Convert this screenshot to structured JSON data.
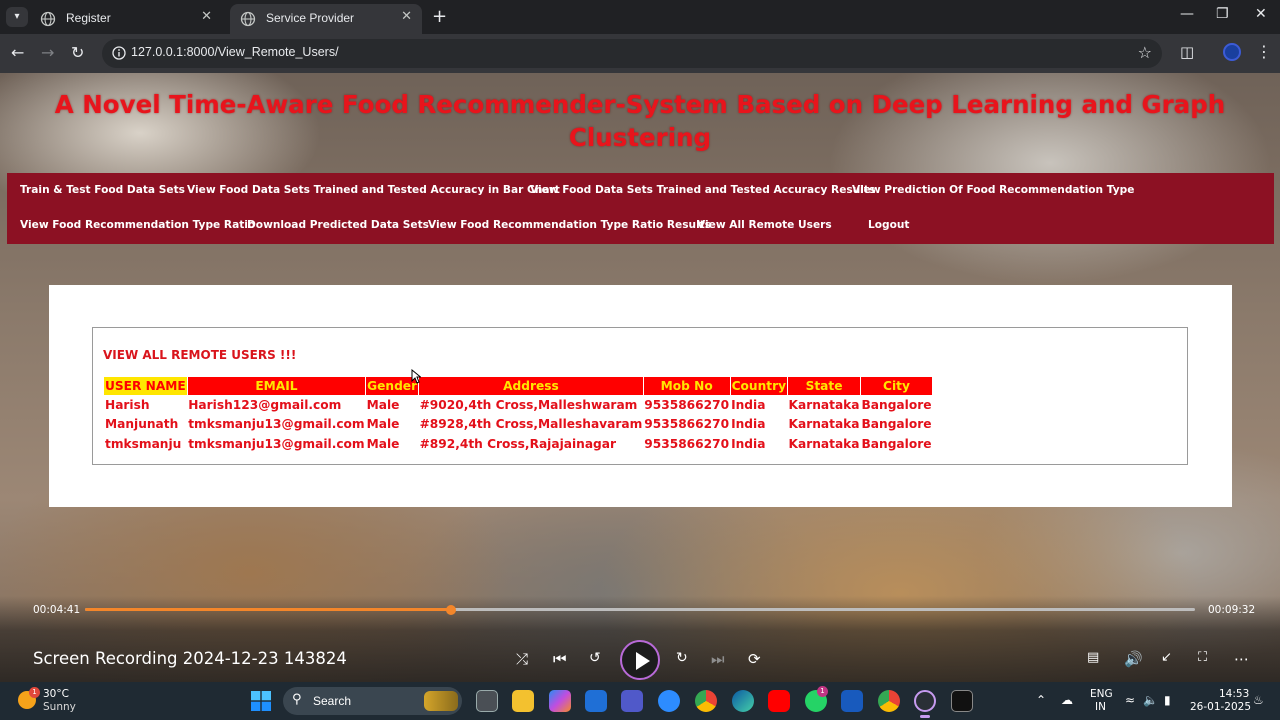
{
  "browser": {
    "tabs": [
      {
        "title": "Register",
        "active": false
      },
      {
        "title": "Service Provider",
        "active": true
      }
    ],
    "url": "127.0.0.1:8000/View_Remote_Users/"
  },
  "page": {
    "title": "A Novel Time-Aware Food Recommender-System Based on Deep Learning and Graph Clustering",
    "menu_row1": [
      "Train & Test Food Data Sets",
      "View Food Data Sets Trained and Tested Accuracy in Bar Chart",
      "View Food Data Sets Trained and Tested Accuracy Results",
      "View Prediction Of Food Recommendation Type"
    ],
    "menu_row2": [
      "View Food Recommendation Type Ratio",
      "Download Predicted Data Sets",
      "View Food Recommendation Type Ratio Results",
      "View All Remote Users",
      "Logout"
    ],
    "section_heading": "VIEW ALL REMOTE USERS !!!",
    "table": {
      "headers": [
        "USER NAME",
        "EMAIL",
        "Gender",
        "Address",
        "Mob No",
        "Country",
        "State",
        "City"
      ],
      "rows": [
        [
          "Harish",
          "Harish123@gmail.com",
          "Male",
          "#9020,4th Cross,Malleshwaram",
          "9535866270",
          "India",
          "Karnataka",
          "Bangalore"
        ],
        [
          "Manjunath",
          "tmksmanju13@gmail.com",
          "Male",
          "#8928,4th Cross,Malleshavaram",
          "9535866270",
          "India",
          "Karnataka",
          "Bangalore"
        ],
        [
          "tmksmanju",
          "tmksmanju13@gmail.com",
          "Male",
          "#892,4th Cross,Rajajainagar",
          "9535866270",
          "India",
          "Karnataka",
          "Bangalore"
        ]
      ]
    }
  },
  "player": {
    "current_time": "00:04:41",
    "total_time": "00:09:32",
    "progress_fraction": 0.33,
    "title": "Screen Recording 2024-12-23 143824"
  },
  "taskbar": {
    "weather_temp": "30°C",
    "weather_condition": "Sunny",
    "weather_badge": "1",
    "search_label": "Search",
    "lang_top": "ENG",
    "lang_bottom": "IN",
    "time": "14:53",
    "date": "26-01-2025",
    "whatsapp_badge": "1"
  },
  "colors": {
    "title_red": "#e8141c",
    "menu_bg": "#8c1123",
    "header_bg": "#ff0000",
    "header_text": "#ffe600",
    "accent_orange": "#f4862a"
  }
}
